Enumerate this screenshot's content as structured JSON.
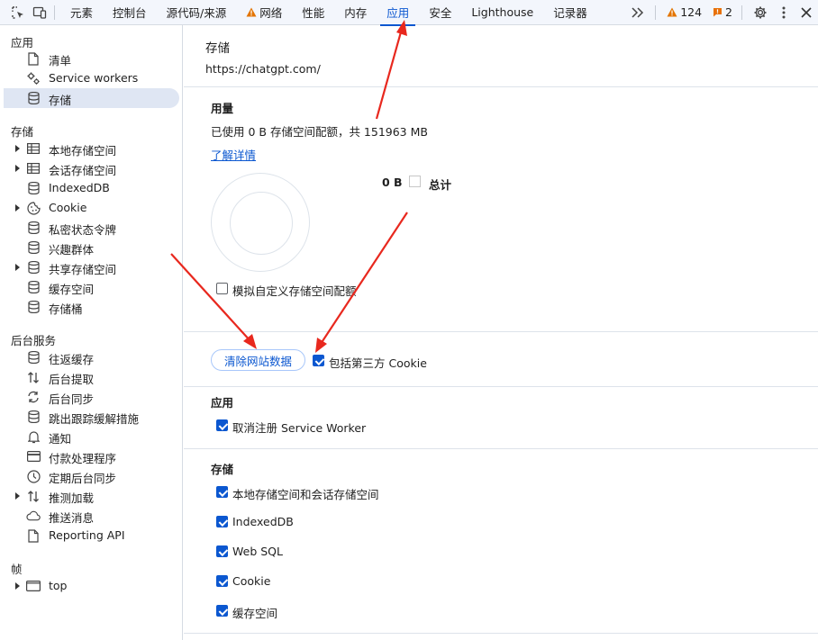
{
  "toolbar": {
    "tabs": [
      "元素",
      "控制台",
      "源代码/来源",
      "网络",
      "性能",
      "内存",
      "应用",
      "安全",
      "Lighthouse",
      "记录器"
    ],
    "warnings": "124",
    "issues": "2",
    "colors": {
      "accent": "#0b57d0",
      "warn": "#e37400",
      "issue": "#e8710a"
    }
  },
  "sidebar": {
    "sections": {
      "app": "应用",
      "storage": "存储",
      "background": "后台服务",
      "frames": "帧"
    },
    "app_items": [
      "清单",
      "Service workers",
      "存储"
    ],
    "storage_items": [
      "本地存储空间",
      "会话存储空间",
      "IndexedDB",
      "Cookie",
      "私密状态令牌",
      "兴趣群体",
      "共享存储空间",
      "缓存空间",
      "存储桶"
    ],
    "background_items": [
      "往返缓存",
      "后台提取",
      "后台同步",
      "跳出跟踪缓解措施",
      "通知",
      "付款处理程序",
      "定期后台同步",
      "推测加载",
      "推送消息",
      "Reporting API"
    ],
    "frame_items": [
      "top"
    ]
  },
  "main": {
    "title": "存储",
    "url": "https://chatgpt.com/",
    "usage": {
      "heading": "用量",
      "summary": "已使用 0 B 存储空间配额，共 151963 MB",
      "learn_more": "了解详情",
      "legend_value": "0 B",
      "legend_label": "总计",
      "simulate_label": "模拟自定义存储空间配额"
    },
    "clear_button": "清除网站数据",
    "third_party_cookie": "包括第三方 Cookie",
    "app_section": {
      "heading": "应用",
      "items": [
        "取消注册 Service Worker"
      ]
    },
    "storage_section": {
      "heading": "存储",
      "items": [
        "本地存储空间和会话存储空间",
        "IndexedDB",
        "Web SQL",
        "Cookie",
        "缓存空间"
      ]
    }
  }
}
